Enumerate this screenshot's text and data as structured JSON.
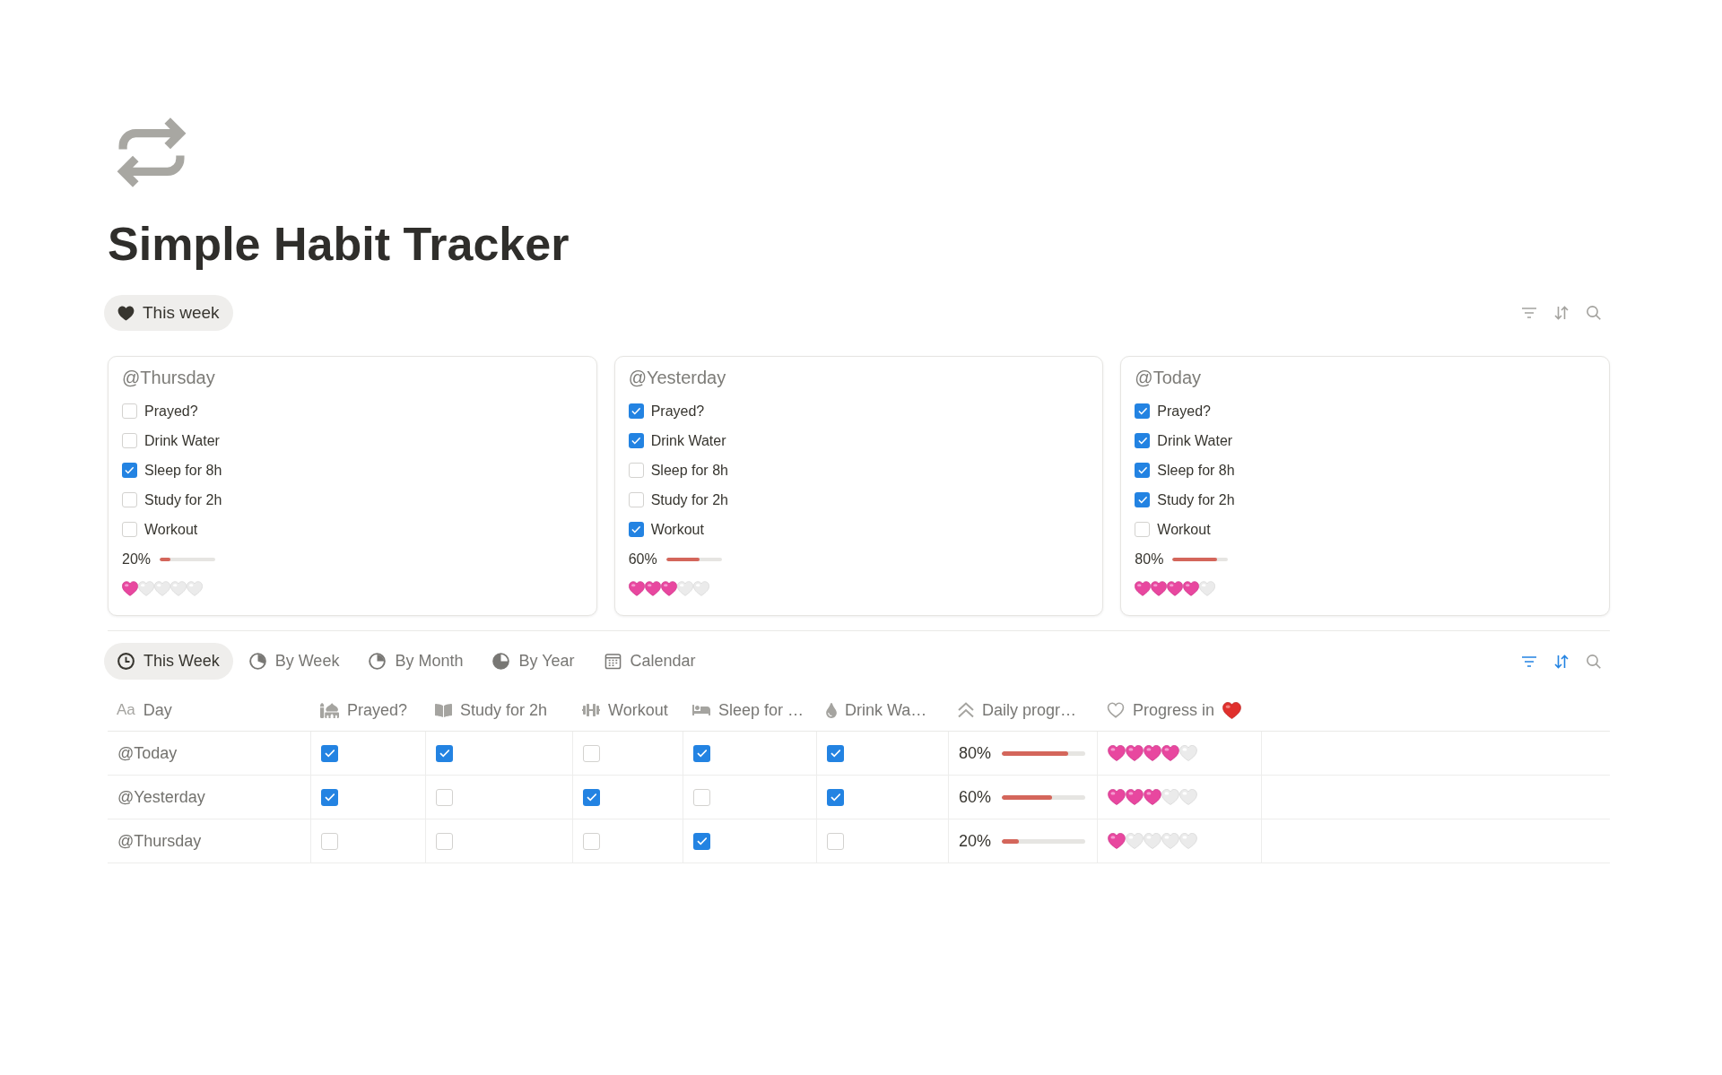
{
  "page": {
    "title": "Simple Habit Tracker"
  },
  "top_tabs": [
    {
      "label": "This week",
      "selected": true
    }
  ],
  "top_toolbar": [
    {
      "kind": "filter",
      "active": false
    },
    {
      "kind": "sort",
      "active": false
    },
    {
      "kind": "search",
      "active": false
    }
  ],
  "cards": [
    {
      "title": "@Thursday",
      "items": [
        {
          "label": "Prayed?",
          "checked": false
        },
        {
          "label": "Drink Water",
          "checked": false
        },
        {
          "label": "Sleep for 8h",
          "checked": true
        },
        {
          "label": "Study for 2h",
          "checked": false
        },
        {
          "label": "Workout",
          "checked": false
        }
      ],
      "reading": "20%",
      "level": 0.2,
      "stars": 1
    },
    {
      "title": "@Yesterday",
      "items": [
        {
          "label": "Prayed?",
          "checked": true
        },
        {
          "label": "Drink Water",
          "checked": true
        },
        {
          "label": "Sleep for 8h",
          "checked": false
        },
        {
          "label": "Study for 2h",
          "checked": false
        },
        {
          "label": "Workout",
          "checked": true
        }
      ],
      "reading": "60%",
      "level": 0.6,
      "stars": 3
    },
    {
      "title": "@Today",
      "items": [
        {
          "label": "Prayed?",
          "checked": true
        },
        {
          "label": "Drink Water",
          "checked": true
        },
        {
          "label": "Sleep for 8h",
          "checked": true
        },
        {
          "label": "Study for 2h",
          "checked": true
        },
        {
          "label": "Workout",
          "checked": false
        }
      ],
      "reading": "80%",
      "level": 0.8,
      "stars": 4
    }
  ],
  "view_tabs": [
    {
      "label": "This Week",
      "selected": true
    },
    {
      "label": "By Week",
      "selected": false
    },
    {
      "label": "By Month",
      "selected": false
    },
    {
      "label": "By Year",
      "selected": false
    },
    {
      "label": "Calendar",
      "selected": false
    }
  ],
  "toolbar": [
    {
      "kind": "filter",
      "active": true
    },
    {
      "kind": "sort",
      "active": true
    },
    {
      "kind": "search",
      "active": false
    }
  ],
  "table": {
    "columns": [
      {
        "kind": "title",
        "type_glyph": "Aa",
        "label": "Day"
      },
      {
        "kind": "checkbox",
        "label": "Prayed?"
      },
      {
        "kind": "checkbox",
        "label": "Study for 2h"
      },
      {
        "kind": "checkbox",
        "label": "Workout"
      },
      {
        "kind": "checkbox",
        "label": "Sleep for …"
      },
      {
        "kind": "checkbox",
        "label": "Drink Wa…"
      },
      {
        "kind": "progress",
        "label": "Daily progr…"
      },
      {
        "kind": "hearts",
        "label": "Progress in"
      }
    ],
    "rows": [
      {
        "cells": [
          {
            "text": "@Today"
          },
          {
            "checked": true
          },
          {
            "checked": true
          },
          {
            "checked": false
          },
          {
            "checked": true
          },
          {
            "checked": true
          },
          {
            "reading": "80%",
            "level": 0.8
          },
          {
            "stars": 4
          }
        ]
      },
      {
        "cells": [
          {
            "text": "@Yesterday"
          },
          {
            "checked": true
          },
          {
            "checked": false
          },
          {
            "checked": true
          },
          {
            "checked": false
          },
          {
            "checked": true
          },
          {
            "reading": "60%",
            "level": 0.6
          },
          {
            "stars": 3
          }
        ]
      },
      {
        "cells": [
          {
            "text": "@Thursday"
          },
          {
            "checked": false
          },
          {
            "checked": false
          },
          {
            "checked": false
          },
          {
            "checked": true
          },
          {
            "checked": false
          },
          {
            "reading": "20%",
            "level": 0.2
          },
          {
            "stars": 1
          }
        ]
      }
    ]
  }
}
